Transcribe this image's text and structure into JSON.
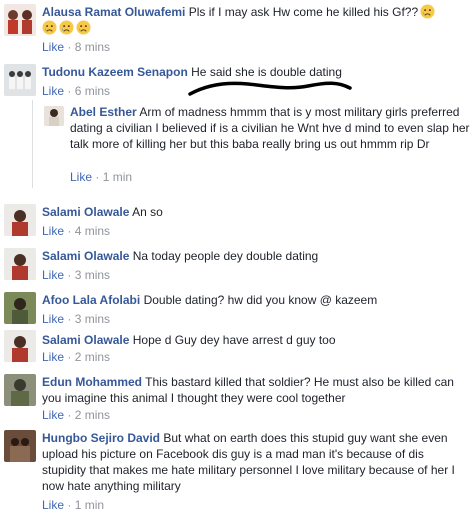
{
  "comments": [
    {
      "name": "Alausa Ramat Oluwafemi",
      "text": "Pls if I may ask Hw come he killed his Gf??",
      "emoji": [
        "crying-face",
        "crying-face",
        "crying-face",
        "crying-face"
      ],
      "like": "Like",
      "sep": "·",
      "time": "8 mins"
    },
    {
      "name": "Tudonu Kazeem Senapon",
      "text": "He said she is double dating",
      "like": "Like",
      "sep": "·",
      "time": "6 mins"
    },
    {
      "name": "Abel Esther",
      "text": "Arm of madness hmmm that is y most military girls preferred dating a civilian I believed if is a civilian he Wnt hve d mind to even slap her talk more of killing her but this baba really bring us out hmmm rip Dr",
      "like": "Like",
      "sep": "·",
      "time": "1 min"
    },
    {
      "name": "Salami Olawale",
      "text": "An so",
      "like": "Like",
      "sep": "·",
      "time": "4 mins"
    },
    {
      "name": "Salami Olawale",
      "text": "Na today people dey double dating",
      "like": "Like",
      "sep": "·",
      "time": "3 mins"
    },
    {
      "name": "Afoo Lala Afolabi",
      "text": "Double dating? hw did you know @ kazeem",
      "like": "Like",
      "sep": "·",
      "time": "3 mins"
    },
    {
      "name": "Salami Olawale",
      "text": "Hope d Guy dey have arrest d guy too",
      "like": "Like",
      "sep": "·",
      "time": "2 mins"
    },
    {
      "name": "Edun Mohammed",
      "text": "This bastard killed that soldier? He must also be killed can you imagine this animal I thought they were cool together",
      "like": "Like",
      "sep": "·",
      "time": "2 mins"
    },
    {
      "name": "Hungbo Sejiro David",
      "text": "But what on earth does this stupid guy want she even upload his picture on Facebook dis guy is a mad man it's because of dis stupidity that makes me hate military personnel I love military because of her I now hate anything military",
      "like": "Like",
      "sep": "·",
      "time": "1 min"
    }
  ],
  "colors": {
    "name": "#365899",
    "like": "#4267b2",
    "meta": "#90949c",
    "text": "#1d2129",
    "scribble": "#000000"
  }
}
